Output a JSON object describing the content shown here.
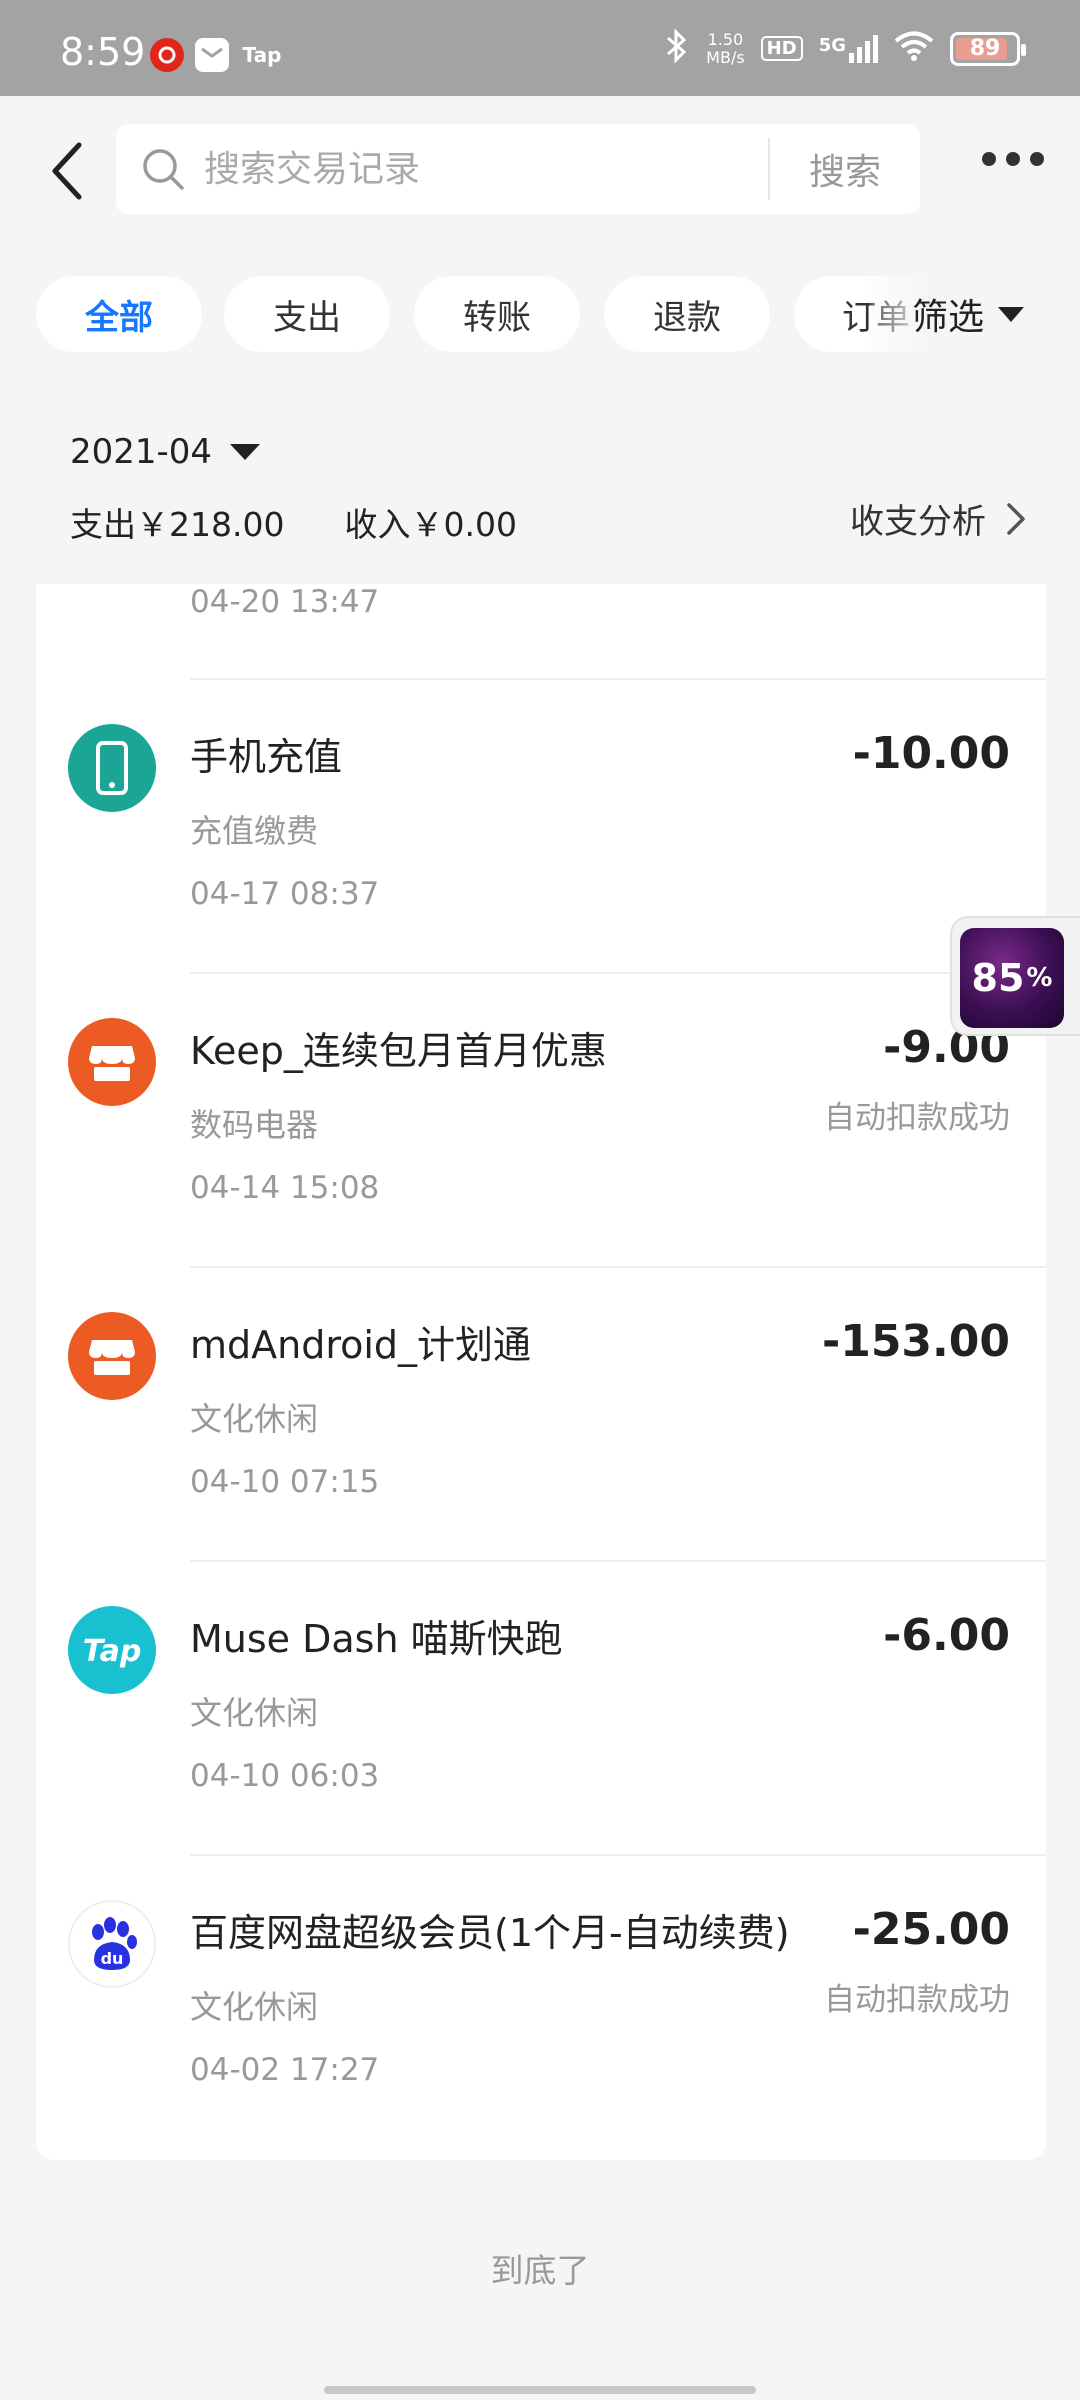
{
  "status_bar": {
    "time": "8:59",
    "net_speed_value": "1.50",
    "net_speed_unit": "MB/s",
    "hd": "HD",
    "network": "5G",
    "battery": "89",
    "battery_level": 0.89,
    "tap_app": "Tap"
  },
  "header": {
    "search_placeholder": "搜索交易记录",
    "search_button": "搜索"
  },
  "tabs": [
    {
      "label": "全部",
      "active": true
    },
    {
      "label": "支出",
      "active": false
    },
    {
      "label": "转账",
      "active": false
    },
    {
      "label": "退款",
      "active": false
    },
    {
      "label": "订单",
      "active": false
    }
  ],
  "filter_label": "筛选",
  "month": "2021-04",
  "summary": {
    "expense": "支出￥218.00",
    "income": "收入￥0.00",
    "analysis": "收支分析"
  },
  "partial_row_time": "04-20 13:47",
  "transactions": [
    {
      "title": "手机充值",
      "category": "充值缴费",
      "time": "04-17 08:37",
      "amount": "-10.00",
      "status": "",
      "icon": "phone-icon",
      "icon_color": "#1aa595"
    },
    {
      "title": "Keep_连续包月首月优惠",
      "category": "数码电器",
      "time": "04-14 15:08",
      "amount": "-9.00",
      "status": "自动扣款成功",
      "icon": "shop-icon",
      "icon_color": "#ec5b24"
    },
    {
      "title": "mdAndroid_计划通",
      "category": "文化休闲",
      "time": "04-10 07:15",
      "amount": "-153.00",
      "status": "",
      "icon": "shop-icon",
      "icon_color": "#ec5b24"
    },
    {
      "title": "Muse Dash 喵斯快跑",
      "category": "文化休闲",
      "time": "04-10 06:03",
      "amount": "-6.00",
      "status": "",
      "icon": "taptap-logo-icon",
      "icon_color": "#19c0cf"
    },
    {
      "title": "百度网盘超级会员(1个月-自动续费)",
      "category": "文化休闲",
      "time": "04-02 17:27",
      "amount": "-25.00",
      "status": "自动扣款成功",
      "icon": "baidu-paw-icon",
      "icon_color": "#2932e1"
    }
  ],
  "end_text": "到底了",
  "float_widget": {
    "value": "85",
    "unit": "%"
  }
}
